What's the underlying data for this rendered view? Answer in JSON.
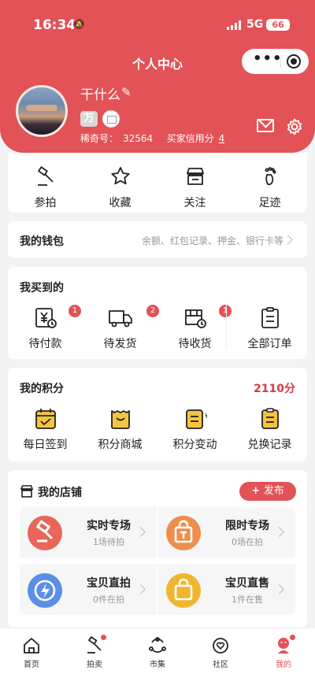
{
  "status_bar": {
    "time": "16:34",
    "network": "5G",
    "battery": "66"
  },
  "header": {
    "title": "个人中心"
  },
  "profile": {
    "username": "干什么",
    "badge_text": "万",
    "id_label": "稀奇号：",
    "id_value": "32564",
    "credit_label": "买家信用分",
    "credit_value": "4"
  },
  "quick_actions": [
    {
      "label": "参拍",
      "icon": "auction-hammer-icon"
    },
    {
      "label": "收藏",
      "icon": "star-icon"
    },
    {
      "label": "关注",
      "icon": "store-icon"
    },
    {
      "label": "足迹",
      "icon": "footprint-icon"
    }
  ],
  "wallet": {
    "title": "我的钱包",
    "subtitle": "余额、红包记录、押金、银行卡等"
  },
  "orders": {
    "title": "我买到的",
    "items": [
      {
        "label": "待付款",
        "count": "1",
        "icon": "payment-icon"
      },
      {
        "label": "待发货",
        "count": "2",
        "icon": "truck-icon"
      },
      {
        "label": "待收货",
        "count": "1",
        "icon": "package-icon"
      },
      {
        "label": "全部订单",
        "count": "",
        "icon": "clipboard-icon"
      }
    ]
  },
  "points": {
    "title": "我的积分",
    "total": "2110分",
    "items": [
      {
        "label": "每日签到",
        "icon": "calendar-check-icon"
      },
      {
        "label": "积分商城",
        "icon": "shopping-bag-icon"
      },
      {
        "label": "积分变动",
        "icon": "points-change-icon"
      },
      {
        "label": "兑换记录",
        "icon": "exchange-record-icon"
      }
    ]
  },
  "shop": {
    "title": "我的店铺",
    "publish_label": "发布",
    "tiles": [
      {
        "title": "实时专场",
        "subtitle": "1场待拍",
        "color": "#e8665a",
        "icon": "hammer-icon"
      },
      {
        "title": "限时专场",
        "subtitle": "0场在拍",
        "color": "#ee8f4e",
        "icon": "timed-bag-icon"
      },
      {
        "title": "宝贝直拍",
        "subtitle": "0件在拍",
        "color": "#5b8fe6",
        "icon": "lightning-icon"
      },
      {
        "title": "宝贝直售",
        "subtitle": "1件在售",
        "color": "#f0b62f",
        "icon": "bag-icon"
      }
    ]
  },
  "tabbar": [
    {
      "label": "首页",
      "icon": "home-icon",
      "dot": false,
      "active": false
    },
    {
      "label": "拍卖",
      "icon": "auction-icon",
      "dot": true,
      "active": false
    },
    {
      "label": "市集",
      "icon": "market-icon",
      "dot": false,
      "active": false
    },
    {
      "label": "社区",
      "icon": "community-icon",
      "dot": false,
      "active": false
    },
    {
      "label": "我的",
      "icon": "profile-icon",
      "dot": true,
      "active": true
    }
  ],
  "colors": {
    "brand": "#e25256",
    "points": "#d33d3f",
    "muted": "#999999"
  }
}
